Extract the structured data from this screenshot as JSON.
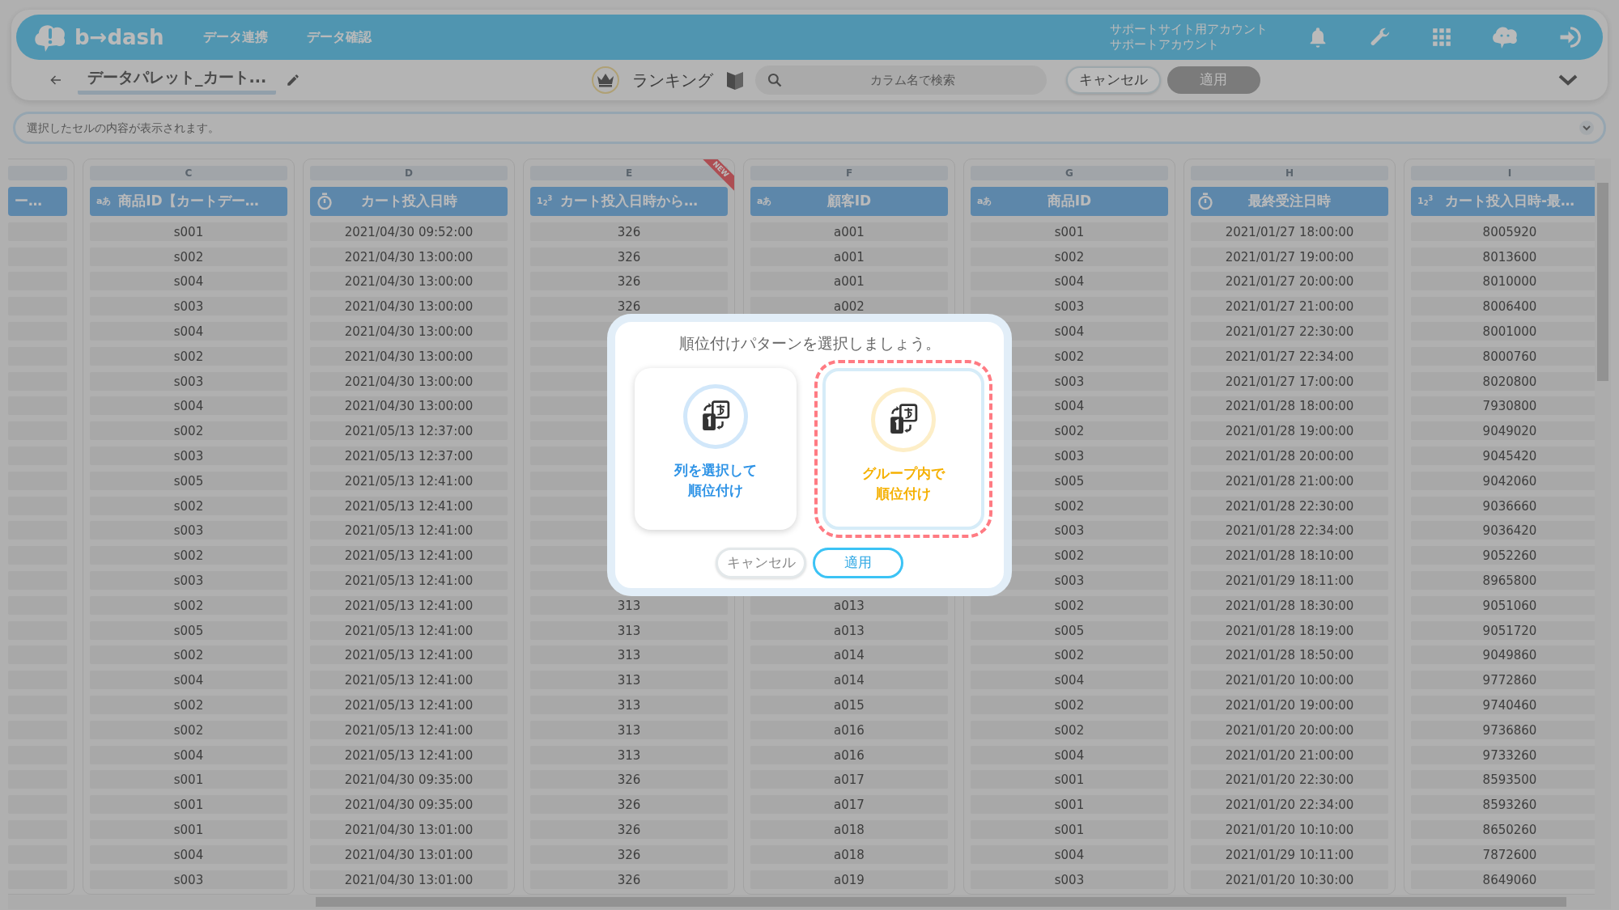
{
  "app": {
    "logo_text": "b→dash",
    "nav": [
      {
        "label": "データ連携"
      },
      {
        "label": "データ確認"
      }
    ],
    "account": {
      "site": "サポートサイト用アカウント",
      "name": "サポートアカウント"
    }
  },
  "toolbar": {
    "title": "データパレット_カート...",
    "mode_label": "ランキング",
    "search": {
      "placeholder": "カラム名で検索"
    },
    "buttons": [
      {
        "label": "キャンセル",
        "disabled": false
      },
      {
        "label": "適用",
        "disabled": true
      }
    ]
  },
  "cell_viewer": {
    "placeholder": "選択したセルの内容が表示されます。"
  },
  "columns": [
    {
      "title": "ー…"
    },
    {
      "letter": "C",
      "kind": "text",
      "type_label": "aあ",
      "title": "商品ID【カートデー…"
    },
    {
      "letter": "D",
      "kind": "datetime",
      "title": "カート投入日時"
    },
    {
      "letter": "E",
      "kind": "number",
      "type_label": "1$_{2}$$^{3}$",
      "title": "カート投入日時から…",
      "badge": "NEW"
    },
    {
      "letter": "F",
      "kind": "text",
      "type_label": "aあ",
      "title": "顧客ID"
    },
    {
      "letter": "G",
      "kind": "text",
      "type_label": "aあ",
      "title": "商品ID"
    },
    {
      "letter": "H",
      "kind": "datetime",
      "title": "最終受注日時"
    },
    {
      "letter": "I",
      "kind": "number",
      "type_label": "1$_{2}$$^{3}$",
      "title": "カート投入日時-最…"
    }
  ],
  "rows": [
    [
      null,
      "s001",
      "2021/04/30 09:52:00",
      "326",
      "a001",
      "s001",
      "2021/01/27 18:00:00",
      "8005920"
    ],
    [
      null,
      "s002",
      "2021/04/30 13:00:00",
      "326",
      "a001",
      "s002",
      "2021/01/27 19:00:00",
      "8013600"
    ],
    [
      null,
      "s004",
      "2021/04/30 13:00:00",
      "326",
      "a001",
      "s004",
      "2021/01/27 20:00:00",
      "8010000"
    ],
    [
      null,
      "s003",
      "2021/04/30 13:00:00",
      "326",
      "a002",
      "s003",
      "2021/01/27 21:00:00",
      "8006400"
    ],
    [
      null,
      "s004",
      "2021/04/30 13:00:00",
      null,
      null,
      "s004",
      "2021/01/27 22:30:00",
      "8001000"
    ],
    [
      null,
      "s002",
      "2021/04/30 13:00:00",
      null,
      null,
      "s002",
      "2021/01/27 22:34:00",
      "8000760"
    ],
    [
      null,
      "s003",
      "2021/04/30 13:00:00",
      null,
      null,
      "s003",
      "2021/01/27 17:00:00",
      "8020800"
    ],
    [
      null,
      "s004",
      "2021/04/30 13:00:00",
      null,
      null,
      "s004",
      "2021/01/28 18:00:00",
      "7930800"
    ],
    [
      null,
      "s002",
      "2021/05/13 12:37:00",
      null,
      null,
      "s002",
      "2021/01/28 19:00:00",
      "9049020"
    ],
    [
      null,
      "s003",
      "2021/05/13 12:37:00",
      null,
      null,
      "s003",
      "2021/01/28 20:00:00",
      "9045420"
    ],
    [
      null,
      "s005",
      "2021/05/13 12:41:00",
      null,
      null,
      "s005",
      "2021/01/28 21:00:00",
      "9042060"
    ],
    [
      null,
      "s002",
      "2021/05/13 12:41:00",
      null,
      null,
      "s002",
      "2021/01/28 22:30:00",
      "9036660"
    ],
    [
      null,
      "s003",
      "2021/05/13 12:41:00",
      null,
      null,
      "s003",
      "2021/01/28 22:34:00",
      "9036420"
    ],
    [
      null,
      "s002",
      "2021/05/13 12:41:00",
      null,
      null,
      "s002",
      "2021/01/28 18:10:00",
      "9052260"
    ],
    [
      null,
      "s003",
      "2021/05/13 12:41:00",
      null,
      null,
      "s003",
      "2021/01/29 18:11:00",
      "8965800"
    ],
    [
      null,
      "s002",
      "2021/05/13 12:41:00",
      "313",
      "a013",
      "s002",
      "2021/01/28 18:30:00",
      "9051060"
    ],
    [
      null,
      "s005",
      "2021/05/13 12:41:00",
      "313",
      "a013",
      "s005",
      "2021/01/28 18:19:00",
      "9051720"
    ],
    [
      null,
      "s002",
      "2021/05/13 12:41:00",
      "313",
      "a014",
      "s002",
      "2021/01/28 18:50:00",
      "9049860"
    ],
    [
      null,
      "s004",
      "2021/05/13 12:41:00",
      "313",
      "a014",
      "s004",
      "2021/01/20 10:00:00",
      "9772860"
    ],
    [
      null,
      "s002",
      "2021/05/13 12:41:00",
      "313",
      "a015",
      "s002",
      "2021/01/20 19:00:00",
      "9740460"
    ],
    [
      null,
      "s002",
      "2021/05/13 12:41:00",
      "313",
      "a016",
      "s002",
      "2021/01/20 20:00:00",
      "9736860"
    ],
    [
      null,
      "s004",
      "2021/05/13 12:41:00",
      "313",
      "a016",
      "s004",
      "2021/01/20 21:00:00",
      "9733260"
    ],
    [
      null,
      "s001",
      "2021/04/30 09:35:00",
      "326",
      "a017",
      "s001",
      "2021/01/20 22:30:00",
      "8593500"
    ],
    [
      null,
      "s001",
      "2021/04/30 09:35:00",
      "326",
      "a017",
      "s001",
      "2021/01/20 22:34:00",
      "8593260"
    ],
    [
      null,
      "s001",
      "2021/04/30 13:01:00",
      "326",
      "a018",
      "s001",
      "2021/01/20 10:10:00",
      "8650260"
    ],
    [
      null,
      "s004",
      "2021/04/30 13:01:00",
      "326",
      "a018",
      "s004",
      "2021/01/29 10:11:00",
      "7872600"
    ],
    [
      null,
      "s003",
      "2021/04/30 13:01:00",
      "326",
      "a019",
      "s003",
      "2021/01/20 10:30:00",
      "8649060"
    ]
  ],
  "dialog": {
    "title": "順位付けパターンを選択しましょう。",
    "options": [
      {
        "lines": [
          "列を選択して",
          "順位付け"
        ],
        "selected": false,
        "color": "#2e93e6"
      },
      {
        "lines": [
          "グループ内で",
          "順位付け"
        ],
        "selected": true,
        "color": "#f5b000"
      }
    ],
    "buttons": [
      {
        "label": "キャンセル",
        "kind": "secondary"
      },
      {
        "label": "適用",
        "kind": "primary"
      }
    ]
  }
}
